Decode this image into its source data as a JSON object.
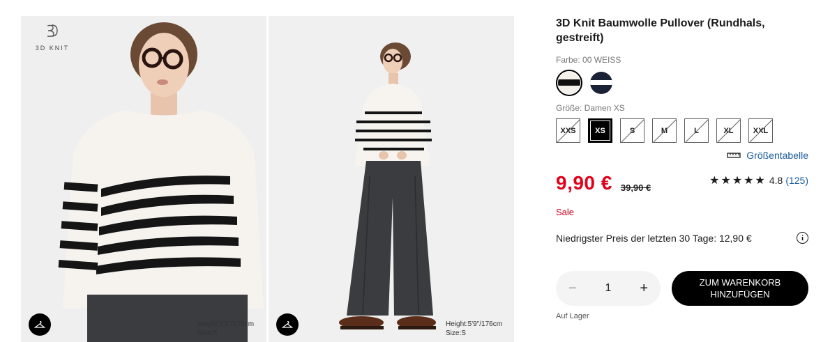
{
  "gallery": {
    "brand_tag": "3D KNIT",
    "photos": [
      {
        "model_height": "Height:5'9\"/176cm",
        "model_size": "Size:S"
      },
      {
        "model_height": "Height:5'9\"/176cm",
        "model_size": "Size:S"
      }
    ]
  },
  "product": {
    "title": "3D Knit Baumwolle Pullover (Rundhals, gestreift)",
    "color_label": "Farbe: 00 WEISS",
    "colors": [
      {
        "name": "00 WEISS",
        "hex": "#f4f1ea",
        "stripe": "#111111",
        "selected": true
      },
      {
        "name": "navy",
        "hex": "#1c2235",
        "stripe": "#ffffff",
        "selected": false
      }
    ],
    "size_label": "Größe: Damen XS",
    "sizes": [
      {
        "label": "XXS",
        "state": "unavailable"
      },
      {
        "label": "XS",
        "state": "selected"
      },
      {
        "label": "S",
        "state": "unavailable"
      },
      {
        "label": "M",
        "state": "unavailable"
      },
      {
        "label": "L",
        "state": "unavailable"
      },
      {
        "label": "XL",
        "state": "unavailable"
      },
      {
        "label": "XXL",
        "state": "unavailable"
      }
    ],
    "size_chart_link": "Größentabelle",
    "price": "9,90 €",
    "old_price": "39,90 €",
    "rating": {
      "stars": "★★★★★",
      "value": "4.8",
      "count": "(125)"
    },
    "sale_label": "Sale",
    "lowest_price_text": "Niedrigster Preis der letzten 30 Tage: 12,90 €",
    "quantity": "1",
    "add_to_cart_line1": "ZUM WARENKORB",
    "add_to_cart_line2": "HINZUFÜGEN",
    "stock_text": "Auf Lager"
  },
  "colors": {
    "price_red": "#e0001a",
    "sale_red": "#c4001c",
    "link_blue": "#1a5b9c"
  }
}
